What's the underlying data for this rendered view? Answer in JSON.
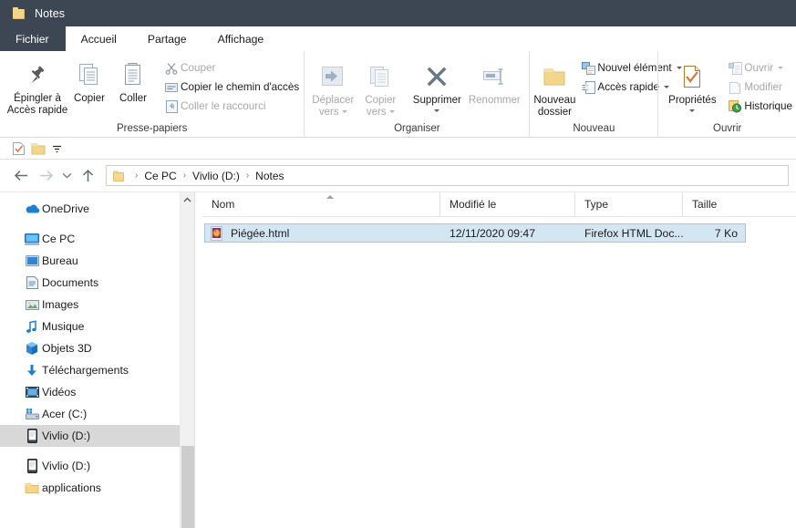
{
  "window": {
    "title": "Notes",
    "folder_icon": "folder-icon"
  },
  "tabs": [
    {
      "label": "Fichier",
      "active": false,
      "kind": "file"
    },
    {
      "label": "Accueil",
      "active": true,
      "kind": "tab"
    },
    {
      "label": "Partage",
      "active": false,
      "kind": "tab"
    },
    {
      "label": "Affichage",
      "active": false,
      "kind": "tab"
    }
  ],
  "ribbon": {
    "groups": [
      {
        "label": "Presse-papiers",
        "big_buttons": [
          {
            "label_line1": "Épingler à",
            "label_line2": "Accès rapide",
            "icon": "pin-icon",
            "disabled": false
          },
          {
            "label_line1": "Copier",
            "label_line2": "",
            "icon": "copy-icon",
            "disabled": false
          },
          {
            "label_line1": "Coller",
            "label_line2": "",
            "icon": "paste-icon",
            "disabled": false
          }
        ],
        "small_buttons": [
          {
            "label": "Couper",
            "icon": "scissors-icon",
            "disabled": true
          },
          {
            "label": "Copier le chemin d'accès",
            "icon": "copy-path-icon",
            "disabled": false
          },
          {
            "label": "Coller le raccourci",
            "icon": "paste-shortcut-icon",
            "disabled": true
          }
        ]
      },
      {
        "label": "Organiser",
        "big_buttons": [
          {
            "label_line1": "Déplacer",
            "label_line2": "vers",
            "icon": "move-to-icon",
            "disabled": true,
            "has_caret": true
          },
          {
            "label_line1": "Copier",
            "label_line2": "vers",
            "icon": "copy-to-icon",
            "disabled": true,
            "has_caret": true
          },
          {
            "label_line1": "Supprimer",
            "label_line2": "",
            "icon": "delete-icon",
            "disabled": false,
            "has_caret": true
          },
          {
            "label_line1": "Renommer",
            "label_line2": "",
            "icon": "rename-icon",
            "disabled": true,
            "has_caret": false
          }
        ]
      },
      {
        "label": "Nouveau",
        "big_buttons": [
          {
            "label_line1": "Nouveau",
            "label_line2": "dossier",
            "icon": "new-folder-icon",
            "disabled": false
          }
        ],
        "small_buttons": [
          {
            "label": "Nouvel élément",
            "icon": "new-item-icon",
            "disabled": false,
            "has_caret": true
          },
          {
            "label": "Accès rapide",
            "icon": "easy-access-icon",
            "disabled": false,
            "has_caret": true
          }
        ]
      },
      {
        "label": "Ouvrir",
        "big_buttons": [
          {
            "label_line1": "Propriétés",
            "label_line2": "",
            "icon": "properties-icon",
            "disabled": false,
            "has_caret": true
          }
        ],
        "small_buttons": [
          {
            "label": "Ouvrir",
            "icon": "open-icon",
            "disabled": true,
            "has_caret": true
          },
          {
            "label": "Modifier",
            "icon": "edit-icon",
            "disabled": true
          },
          {
            "label": "Historique",
            "icon": "history-icon",
            "disabled": false
          }
        ]
      }
    ]
  },
  "quick_access_toolbar": {
    "items": [
      {
        "icon": "properties-qat-icon",
        "name": "properties"
      },
      {
        "icon": "new-folder-qat-icon",
        "name": "new-folder"
      },
      {
        "icon": "customize-dropdown-icon",
        "name": "customize"
      }
    ]
  },
  "address_bar": {
    "back": "back-arrow-icon",
    "forward": "forward-arrow-icon",
    "recent": "recent-locations-icon",
    "up": "up-arrow-icon",
    "breadcrumbs": [
      "Ce PC",
      "Vivlio (D:)",
      "Notes"
    ],
    "separator": "›"
  },
  "nav_pane": {
    "items": [
      {
        "label": "OneDrive",
        "icon": "onedrive-icon",
        "indent": 0,
        "chevron": true,
        "selected": false,
        "gap_before": true
      },
      {
        "label": "Ce PC",
        "icon": "this-pc-icon",
        "indent": 0,
        "chevron": true,
        "selected": false,
        "gap_before": true
      },
      {
        "label": "Bureau",
        "icon": "desktop-icon",
        "indent": 1,
        "chevron": false,
        "selected": false
      },
      {
        "label": "Documents",
        "icon": "documents-icon",
        "indent": 1,
        "chevron": false,
        "selected": false
      },
      {
        "label": "Images",
        "icon": "pictures-icon",
        "indent": 1,
        "chevron": false,
        "selected": false
      },
      {
        "label": "Musique",
        "icon": "music-icon",
        "indent": 1,
        "chevron": false,
        "selected": false
      },
      {
        "label": "Objets 3D",
        "icon": "objects3d-icon",
        "indent": 1,
        "chevron": false,
        "selected": false
      },
      {
        "label": "Téléchargements",
        "icon": "downloads-icon",
        "indent": 1,
        "chevron": false,
        "selected": false
      },
      {
        "label": "Vidéos",
        "icon": "videos-icon",
        "indent": 1,
        "chevron": false,
        "selected": false
      },
      {
        "label": "Acer (C:)",
        "icon": "hard-drive-icon",
        "indent": 1,
        "chevron": false,
        "selected": false
      },
      {
        "label": "Vivlio (D:)",
        "icon": "device-icon",
        "indent": 1,
        "chevron": false,
        "selected": true
      },
      {
        "label": "Vivlio (D:)",
        "icon": "device-icon",
        "indent": 0,
        "chevron": false,
        "selected": false,
        "gap_before": true
      },
      {
        "label": "applications",
        "icon": "folder-icon",
        "indent": 1,
        "chevron": false,
        "selected": false
      }
    ]
  },
  "file_list": {
    "columns": [
      {
        "key": "name",
        "label": "Nom",
        "sorted": true
      },
      {
        "key": "mod",
        "label": "Modifié le",
        "sorted": false
      },
      {
        "key": "type",
        "label": "Type",
        "sorted": false
      },
      {
        "key": "size",
        "label": "Taille",
        "sorted": false
      }
    ],
    "rows": [
      {
        "name": "Piégée.html",
        "modified": "12/11/2020 09:47",
        "type": "Firefox HTML Doc...",
        "size": "7 Ko",
        "icon": "firefox-html-icon",
        "selected": true
      }
    ]
  },
  "colors": {
    "titlebar": "#3d4754",
    "selection_fill": "#d5e6f3",
    "selection_border": "#a7c6de",
    "nav_selection": "#d8d8d8",
    "accent_folder": "#f6d891"
  }
}
